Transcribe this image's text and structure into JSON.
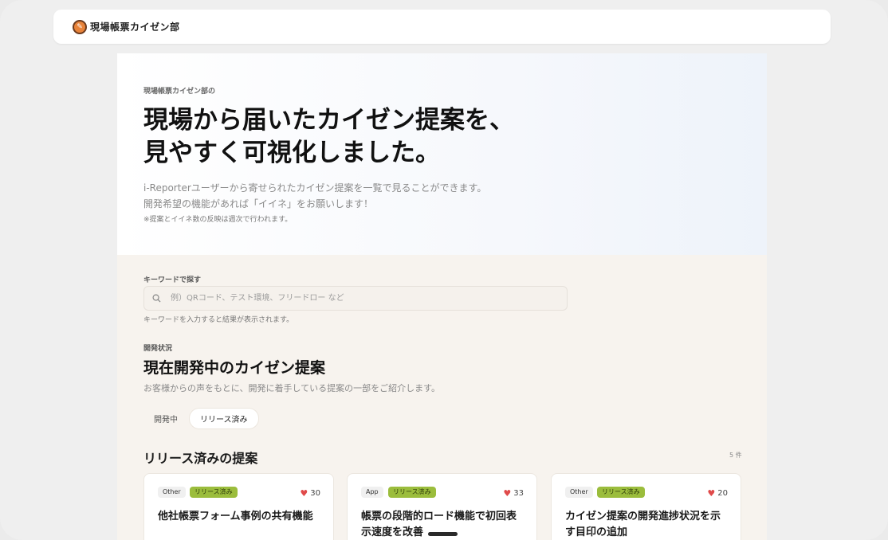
{
  "header": {
    "logo_text": "現場帳票カイゼン部"
  },
  "hero": {
    "eyebrow": "現場帳票カイゼン部の",
    "title_line1": "現場から届いたカイゼン提案を、",
    "title_line2": "見やすく可視化しました。",
    "desc_line1": "i-Reporterユーザーから寄せられたカイゼン提案を一覧で見ることができます。",
    "desc_line2": "開発希望の機能があれば「イイネ」をお願いします！",
    "note": "※提案とイイネ数の反映は週次で行われます。"
  },
  "search": {
    "label": "キーワードで探す",
    "value": "",
    "placeholder": "例）QRコード、テスト環境、フリードロー など",
    "help": "キーワードを入力すると結果が表示されます。"
  },
  "status": {
    "eyebrow": "開発状況",
    "title": "現在開発中のカイゼン提案",
    "desc": "お客様からの声をもとに、開発に着手している提案の一部をご紹介します。",
    "tabs": [
      {
        "label": "開発中",
        "active": false
      },
      {
        "label": "リリース済み",
        "active": true
      }
    ]
  },
  "results": {
    "title": "リリース済みの提案",
    "count": "5 件",
    "cards": [
      {
        "category": "Other",
        "status": "リリース済み",
        "likes": "30",
        "title": "他社帳票フォーム事例の共有機能"
      },
      {
        "category": "App",
        "status": "リリース済み",
        "likes": "33",
        "title": "帳票の段階的ロード機能で初回表示速度を改善"
      },
      {
        "category": "Other",
        "status": "リリース済み",
        "likes": "20",
        "title": "カイゼン提案の開発進捗状況を示す目印の追加"
      }
    ]
  },
  "colors": {
    "accent_green": "#9bbd3c",
    "heart_red": "#e04a4a",
    "page_bg": "#f7f3ee"
  },
  "icons": {
    "search": "search-icon",
    "like": "heart-icon",
    "logo": "logo-icon"
  }
}
